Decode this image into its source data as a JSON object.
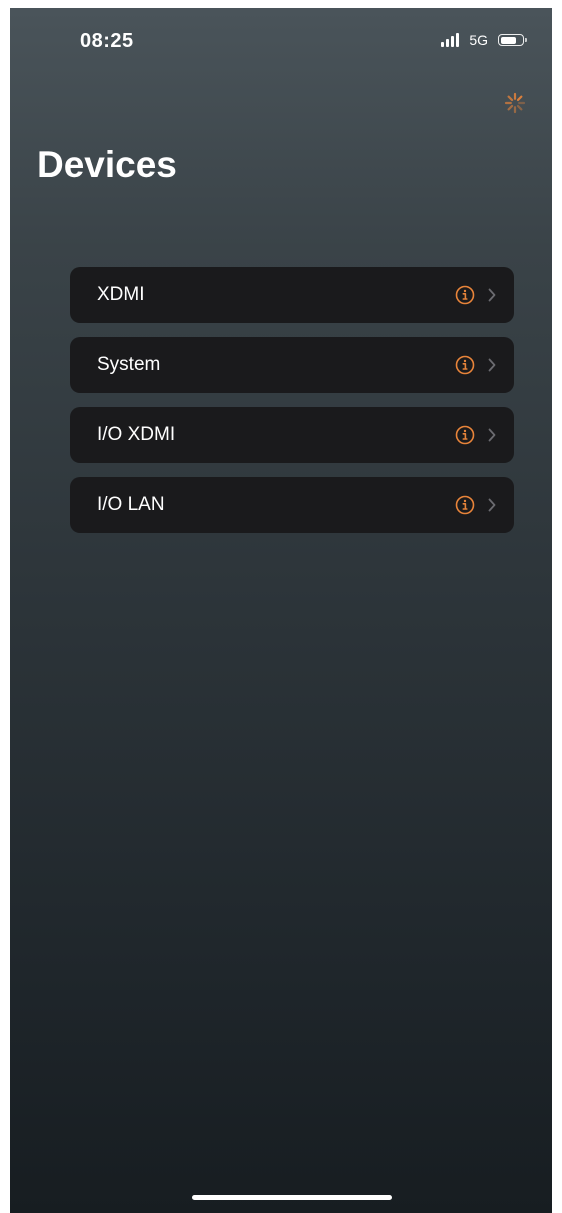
{
  "status_bar": {
    "time": "08:25",
    "network": "5G",
    "battery_level": 0.75
  },
  "header": {
    "title": "Devices"
  },
  "devices": [
    {
      "label": "XDMI"
    },
    {
      "label": "System"
    },
    {
      "label": "I/O XDMI"
    },
    {
      "label": "I/O LAN"
    }
  ],
  "colors": {
    "accent": "#e8843a",
    "row_background": "#1a1a1c",
    "chevron": "#6b6b70"
  },
  "icons": {
    "status_icon": "info-circle-icon",
    "row_arrow": "chevron-right-icon",
    "top_right": "loading-spinner-icon"
  }
}
